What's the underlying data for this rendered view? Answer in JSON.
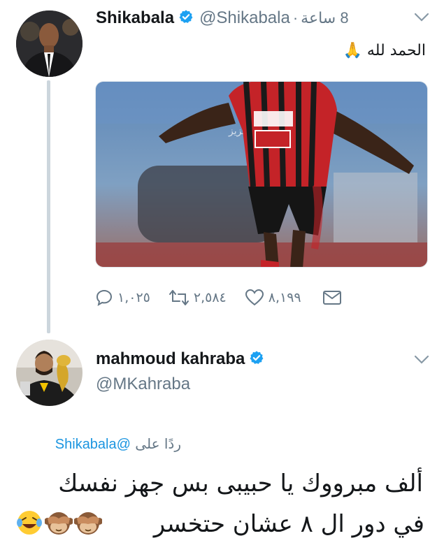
{
  "tweet": {
    "display_name": "Shikabala",
    "handle": "@Shikabala",
    "separator": "·",
    "time": "8 ساعة",
    "text": "الحمد لله 🙏",
    "actions": {
      "reply_count": "١,٠٢٥",
      "retweet_count": "٢,٥٨٤",
      "like_count": "٨,١٩٩"
    }
  },
  "reply": {
    "display_name": "mahmoud kahraba",
    "handle": "@MKahraba",
    "replying_to_label": "ردًا على",
    "replying_to_handle": "@Shikabala",
    "line1": "ألف مبرووك يا حبيبى بس جهز نفسك",
    "line2": "في دور ال ٨ عشان حتخسر"
  },
  "colors": {
    "verified": "#1da1f2",
    "muted": "#657786",
    "link": "#1b95e0",
    "thread_line": "#ccd6dd"
  }
}
